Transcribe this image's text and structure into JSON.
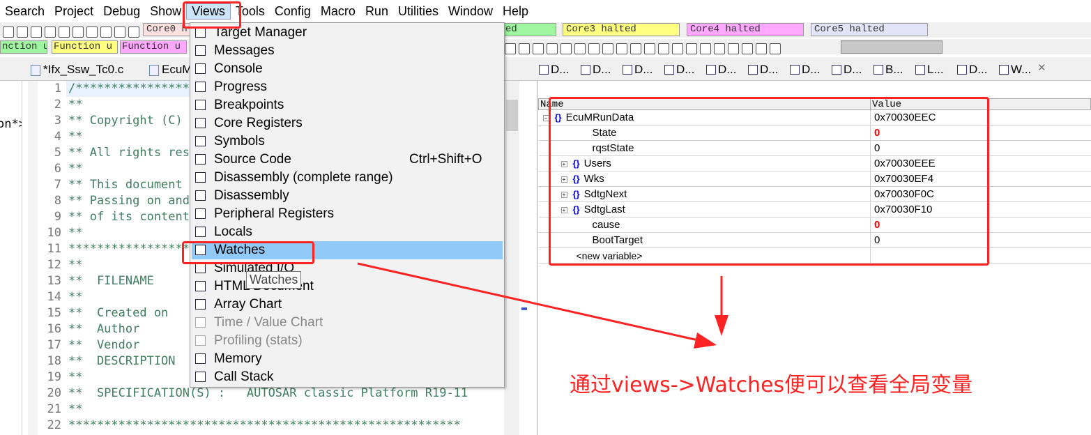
{
  "menubar": [
    "Search",
    "Project",
    "Debug",
    "Show",
    "Views",
    "Tools",
    "Config",
    "Macro",
    "Run",
    "Utilities",
    "Window",
    "Help"
  ],
  "cores": [
    {
      "label": "Core0 h",
      "color": "#fde0e0"
    },
    {
      "label": "ed",
      "color": "#a0f5a0"
    },
    {
      "label": "Core3 halted",
      "color": "#ffff80"
    },
    {
      "label": "Core4 halted",
      "color": "#ffa8ff"
    },
    {
      "label": "Core5 halted",
      "color": "#e4e4f8"
    }
  ],
  "functions": [
    {
      "label": "nction u",
      "color": "#a0f5a0"
    },
    {
      "label": "Function u",
      "color": "#ffff80"
    },
    {
      "label": "Function u",
      "color": "#ffa8ff"
    }
  ],
  "editor": {
    "tabs": [
      "*Ifx_Ssw_Tc0.c",
      "EcuM"
    ],
    "left_fragment": "on*>",
    "lines": [
      "/******************************************************",
      "**",
      "** Copyright (C)",
      "**",
      "** All rights reserved.",
      "**",
      "** This document",
      "** Passing on and",
      "** of its contents",
      "**",
      "*******************************************************",
      "**",
      "**  FILENAME",
      "**",
      "**  Created on",
      "**  Author",
      "**  Vendor",
      "**  DESCRIPTION",
      "**",
      "**  SPECIFICATION(S) :   AUTOSAR classic Platform R19-11",
      "**",
      "*******************************************************"
    ]
  },
  "right_tabs": [
    "D...",
    "D...",
    "D...",
    "D...",
    "D...",
    "D...",
    "D...",
    "D...",
    "B...",
    "L...",
    "D...",
    "W..."
  ],
  "watch": {
    "headers": [
      "Name",
      "Value"
    ],
    "rows": [
      {
        "name": "EcuMRunData",
        "value": "0x70030EEC",
        "level": 0,
        "expander": "−",
        "struct": true
      },
      {
        "name": "State",
        "value": "0",
        "level": 1,
        "changed": true
      },
      {
        "name": "rqstState",
        "value": "0",
        "level": 1
      },
      {
        "name": "Users",
        "value": "0x70030EEE",
        "level": 1,
        "expander": "+",
        "struct": true
      },
      {
        "name": "Wks",
        "value": "0x70030EF4",
        "level": 1,
        "expander": "+",
        "struct": true
      },
      {
        "name": "SdtgNext",
        "value": "0x70030F0C",
        "level": 1,
        "expander": "+",
        "struct": true
      },
      {
        "name": "SdtgLast",
        "value": "0x70030F10",
        "level": 1,
        "expander": "+",
        "struct": true
      },
      {
        "name": "cause",
        "value": "0",
        "level": 1,
        "changed": true
      },
      {
        "name": "BootTarget",
        "value": "0",
        "level": 1
      }
    ],
    "new_variable": "<new variable>"
  },
  "views_menu": [
    {
      "label": "Target Manager"
    },
    {
      "label": "Messages"
    },
    {
      "label": "Console"
    },
    {
      "label": "Progress"
    },
    {
      "label": "Breakpoints"
    },
    {
      "label": "Core Registers"
    },
    {
      "label": "Symbols"
    },
    {
      "label": "Source Code",
      "shortcut": "Ctrl+Shift+O"
    },
    {
      "label": "Disassembly (complete range)"
    },
    {
      "label": "Disassembly"
    },
    {
      "label": "Peripheral Registers"
    },
    {
      "label": "Locals"
    },
    {
      "label": "Watches",
      "selected": true
    },
    {
      "label": "Simulated I/O"
    },
    {
      "label": "HTML Document"
    },
    {
      "label": "Array Chart"
    },
    {
      "label": "Time / Value Chart",
      "disabled": true
    },
    {
      "label": "Profiling (stats)",
      "disabled": true
    },
    {
      "label": "Memory"
    },
    {
      "label": "Call Stack"
    }
  ],
  "tooltip": "Watches",
  "annotation": {
    "caption": "通过views->Watches便可以查看全局变量",
    "color": "#ff2222"
  }
}
